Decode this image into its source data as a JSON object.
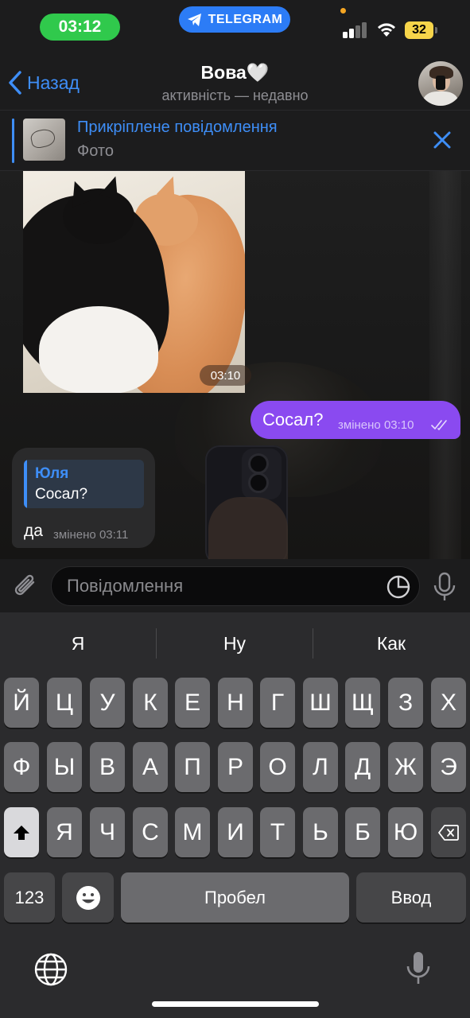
{
  "status_bar": {
    "time": "03:12",
    "active_app": "TELEGRAM",
    "battery": "32",
    "time_pill_color": "#30c94c",
    "app_pill_color": "#2c7cf6",
    "battery_color": "#f7d54a"
  },
  "header": {
    "back_label": "Назад",
    "title": "Вова🤍",
    "subtitle": "активність — недавно",
    "accent": "#3e8ef7"
  },
  "pinned": {
    "title": "Прикріплене повідомлення",
    "subtitle": "Фото"
  },
  "messages": {
    "photo": {
      "time": "03:10"
    },
    "outgoing": {
      "text": "Сосал?",
      "meta": "змінено 03:10",
      "bubble_color": "#8a4af0"
    },
    "incoming": {
      "reply_name": "Юля",
      "reply_text": "Сосал?",
      "text": "да",
      "meta": "змінено 03:11"
    }
  },
  "composer": {
    "placeholder": "Повідомлення"
  },
  "keyboard": {
    "suggestions": [
      "Я",
      "Ну",
      "Как"
    ],
    "row1": [
      "Й",
      "Ц",
      "У",
      "К",
      "Е",
      "Н",
      "Г",
      "Ш",
      "Щ",
      "З",
      "Х"
    ],
    "row2": [
      "Ф",
      "Ы",
      "В",
      "А",
      "П",
      "Р",
      "О",
      "Л",
      "Д",
      "Ж",
      "Э"
    ],
    "row3": [
      "Я",
      "Ч",
      "С",
      "М",
      "И",
      "Т",
      "Ь",
      "Б",
      "Ю"
    ],
    "numbers_label": "123",
    "space_label": "Пробел",
    "return_label": "Ввод"
  }
}
